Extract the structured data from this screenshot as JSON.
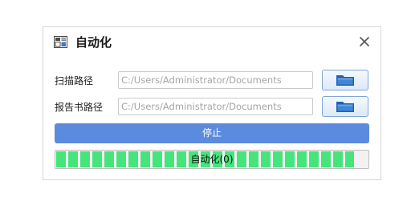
{
  "dialog": {
    "title": "自动化",
    "title_icon": "app-window-icon",
    "close_icon": "close-icon"
  },
  "scan_path": {
    "label": "扫描路径",
    "value": "C:/Users/Administrator/Documents",
    "browse_icon": "folder-icon"
  },
  "report_path": {
    "label": "报告书路径",
    "value": "C:/Users/Administrator/Documents",
    "browse_icon": "folder-icon"
  },
  "stop_button": {
    "label": "停止"
  },
  "progress": {
    "label": "自动化(0)",
    "fraction": 0.955,
    "fill_color": "#45e57b"
  },
  "colors": {
    "accent": "#5b8bdf",
    "folder": "#1f5fb5"
  }
}
